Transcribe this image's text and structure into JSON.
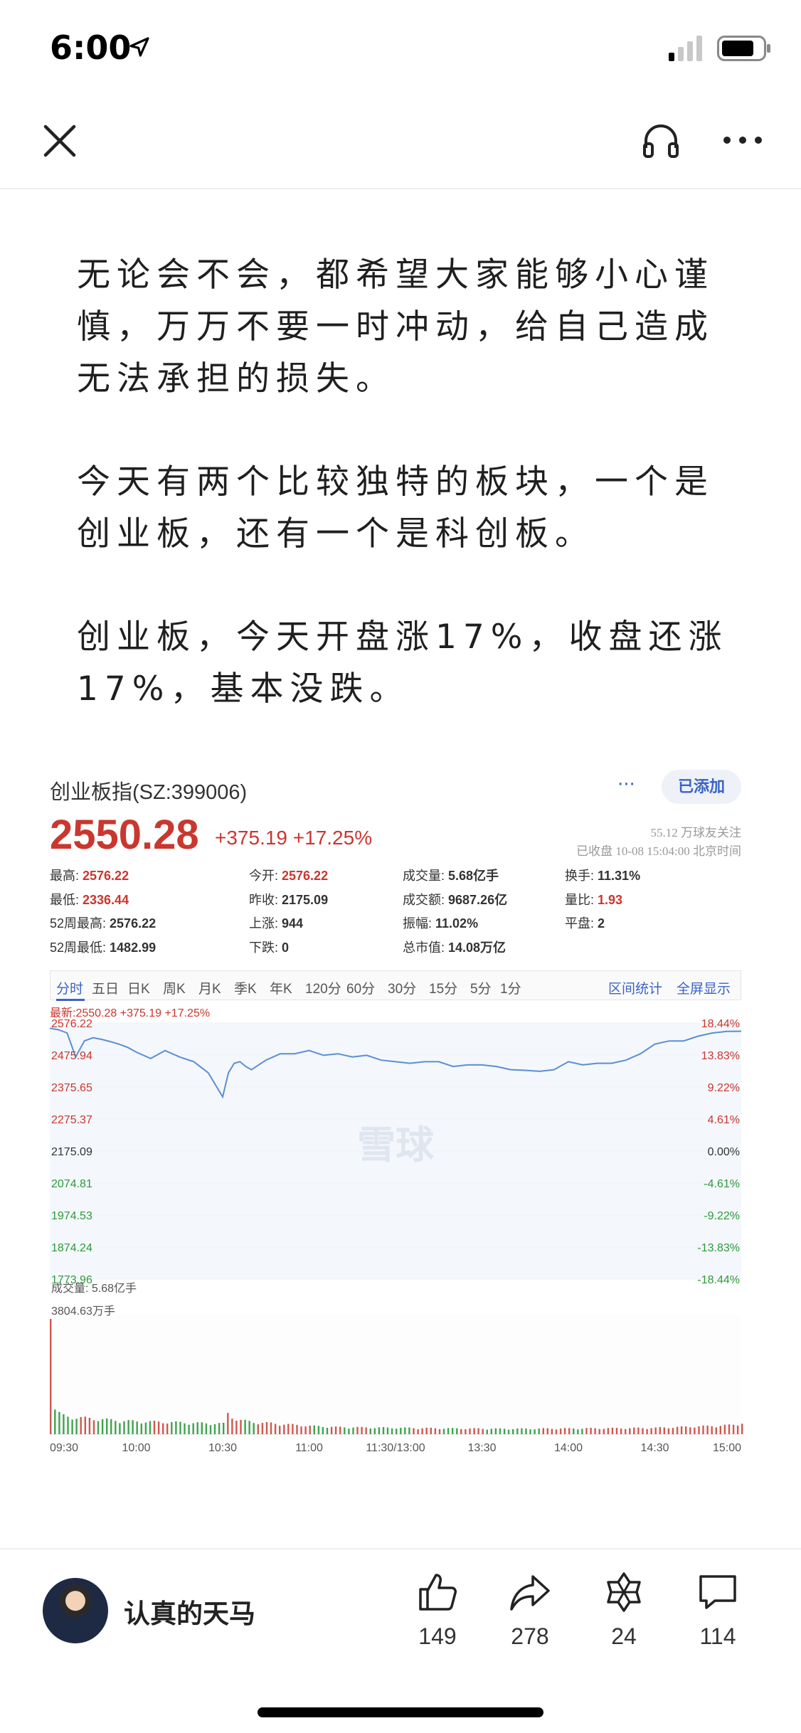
{
  "status_bar": {
    "time": "6:00"
  },
  "article": {
    "paragraphs": [
      "无论会不会，都希望大家能够小心谨慎，万万不要一时冲动，给自己造成无法承担的损失。",
      "今天有两个比较独特的板块，一个是创业板，还有一个是科创板。",
      "创业板，今天开盘涨17%，收盘还涨17%，基本没跌。"
    ]
  },
  "stock_card": {
    "name": "创业板指(SZ:399006)",
    "dots": "···",
    "added_label": "已添加",
    "price": "2550.28",
    "change": "+375.19 +17.25%",
    "followers": "55.12 万球友关注",
    "close_time": "已收盘 10-08 15:04:00 北京时间",
    "quotes": [
      {
        "label": "最高:",
        "value": "2576.22",
        "red": true
      },
      {
        "label": "今开:",
        "value": "2576.22",
        "red": true
      },
      {
        "label": "成交量:",
        "value": "5.68亿手",
        "red": false
      },
      {
        "label": "换手:",
        "value": "11.31%",
        "red": false
      },
      {
        "label": "最低:",
        "value": "2336.44",
        "red": true
      },
      {
        "label": "昨收:",
        "value": "2175.09",
        "red": false
      },
      {
        "label": "成交额:",
        "value": "9687.26亿",
        "red": false
      },
      {
        "label": "量比:",
        "value": "1.93",
        "red": true
      },
      {
        "label": "52周最高:",
        "value": "2576.22",
        "red": false
      },
      {
        "label": "上涨:",
        "value": "944",
        "red": false
      },
      {
        "label": "振幅:",
        "value": "11.02%",
        "red": false
      },
      {
        "label": "平盘:",
        "value": "2",
        "red": false
      },
      {
        "label": "52周最低:",
        "value": "1482.99",
        "red": false
      },
      {
        "label": "下跌:",
        "value": "0",
        "red": false
      },
      {
        "label": "总市值:",
        "value": "14.08万亿",
        "red": false
      }
    ],
    "periods": [
      "分时",
      "五日",
      "日K",
      "周K",
      "月K",
      "季K",
      "年K",
      "120分",
      "60分",
      "30分",
      "15分",
      "5分",
      "1分"
    ],
    "period_active": "分时",
    "period_right": [
      "区间统计",
      "全屏显示"
    ],
    "latest": "最新:2550.28 +375.19 +17.25%",
    "watermark": "雪球",
    "volume_label": "成交量: 5.68亿手",
    "volume_max_label": "3804.63万手"
  },
  "chart_data": {
    "type": "line",
    "title": "",
    "y_ticks_left": [
      "2576.22",
      "2475.94",
      "2375.65",
      "2275.37",
      "2175.09",
      "2074.81",
      "1974.53",
      "1874.24",
      "1773.96"
    ],
    "y_ticks_right": [
      "18.44%",
      "13.83%",
      "9.22%",
      "4.61%",
      "0.00%",
      "-4.61%",
      "-9.22%",
      "-13.83%",
      "-18.44%"
    ],
    "x_ticks": [
      "09:30",
      "10:00",
      "10:30",
      "11:00",
      "11:30/13:00",
      "13:30",
      "14:00",
      "14:30",
      "15:00"
    ],
    "ylim": [
      1773.96,
      2576.22
    ],
    "prev_close": 2175.09,
    "x_minutes": [
      0,
      3,
      6,
      9,
      12,
      15,
      18,
      21,
      24,
      27,
      30,
      35,
      40,
      45,
      50,
      55,
      60,
      62,
      64,
      66,
      68,
      70,
      75,
      80,
      85,
      90,
      95,
      100,
      105,
      110,
      115,
      120,
      125,
      130,
      135,
      140,
      145,
      150,
      155,
      160,
      165,
      170,
      175,
      180,
      185,
      190,
      195,
      200,
      205,
      210,
      215,
      220,
      225,
      230,
      235,
      240
    ],
    "price": [
      2560,
      2555,
      2545,
      2470,
      2520,
      2530,
      2525,
      2518,
      2510,
      2500,
      2485,
      2465,
      2490,
      2470,
      2455,
      2420,
      2345,
      2420,
      2450,
      2455,
      2440,
      2430,
      2460,
      2480,
      2480,
      2490,
      2475,
      2480,
      2470,
      2475,
      2460,
      2455,
      2450,
      2455,
      2455,
      2440,
      2445,
      2445,
      2440,
      2430,
      2428,
      2425,
      2430,
      2455,
      2445,
      2450,
      2450,
      2460,
      2480,
      2510,
      2520,
      2520,
      2535,
      2545,
      2550,
      2550.28
    ],
    "volume_minutes": [
      0,
      1,
      2,
      3,
      4,
      5,
      10,
      15,
      20,
      25,
      30,
      40,
      50,
      60,
      61,
      62,
      63,
      64,
      65,
      70,
      80,
      90,
      100,
      120,
      140,
      160,
      180,
      200,
      210,
      220,
      230,
      235,
      238,
      240
    ],
    "volume": [
      3804.63,
      900,
      700,
      650,
      600,
      550,
      520,
      480,
      450,
      420,
      400,
      380,
      350,
      330,
      700,
      600,
      550,
      500,
      450,
      380,
      320,
      260,
      220,
      200,
      180,
      170,
      180,
      190,
      200,
      230,
      260,
      280,
      300,
      360
    ]
  }
}
